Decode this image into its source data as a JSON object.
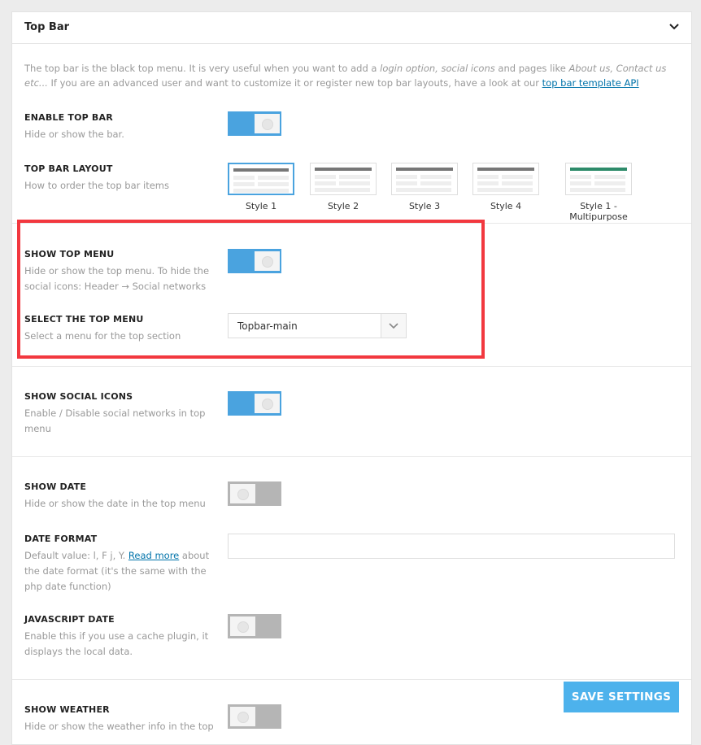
{
  "section": {
    "title": "Top Bar"
  },
  "description": {
    "p1": "The top bar is the black top menu. It is very useful when you want to add a ",
    "em1": "login option, social icons",
    "p2": " and pages like ",
    "em2": "About us, Contact us etc...",
    "p3": " If you are an advanced user and want to customize it or register new top bar layouts, have a look at our ",
    "link": "top bar template API"
  },
  "enable_top_bar": {
    "label": "ENABLE TOP BAR",
    "desc": "Hide or show the bar.",
    "state": "on"
  },
  "top_bar_layout": {
    "label": "TOP BAR LAYOUT",
    "desc": "How to order the top bar items",
    "styles": [
      {
        "name": "Style 1",
        "selected": true
      },
      {
        "name": "Style 2",
        "selected": false
      },
      {
        "name": "Style 3",
        "selected": false
      },
      {
        "name": "Style 4",
        "selected": false
      },
      {
        "name": "Style 1 - Multipurpose",
        "selected": false
      }
    ]
  },
  "show_top_menu": {
    "label": "SHOW TOP MENU",
    "desc1": "Hide or show the top menu. To hide the",
    "desc2": "social icons: Header → Social networks",
    "state": "on"
  },
  "select_top_menu": {
    "label": "SELECT THE TOP MENU",
    "desc": "Select a menu for the top section",
    "value": "Topbar-main"
  },
  "show_social_icons": {
    "label": "SHOW SOCIAL ICONS",
    "desc1": "Enable / Disable social networks in top",
    "desc2": "menu",
    "state": "on"
  },
  "show_date": {
    "label": "SHOW DATE",
    "desc": "Hide or show the date in the top menu",
    "state": "off"
  },
  "date_format": {
    "label": "DATE FORMAT",
    "desc_pre": "Default value: l, F j, Y. ",
    "link": "Read more",
    "desc_post": " about",
    "desc2": "the date format (it's the same with the",
    "desc3": "php date function)",
    "value": ""
  },
  "javascript_date": {
    "label": "JAVASCRIPT DATE",
    "desc1": "Enable this if you use a cache plugin, it",
    "desc2": "displays the local data.",
    "state": "off"
  },
  "show_weather": {
    "label": "SHOW WEATHER",
    "desc1": "Hide or show the weather info in the top",
    "state": "off"
  },
  "save": {
    "label": "SAVE SETTINGS"
  },
  "colors": {
    "accent": "#4aa3df",
    "highlight": "#f2383f",
    "save": "#4db2ec"
  }
}
